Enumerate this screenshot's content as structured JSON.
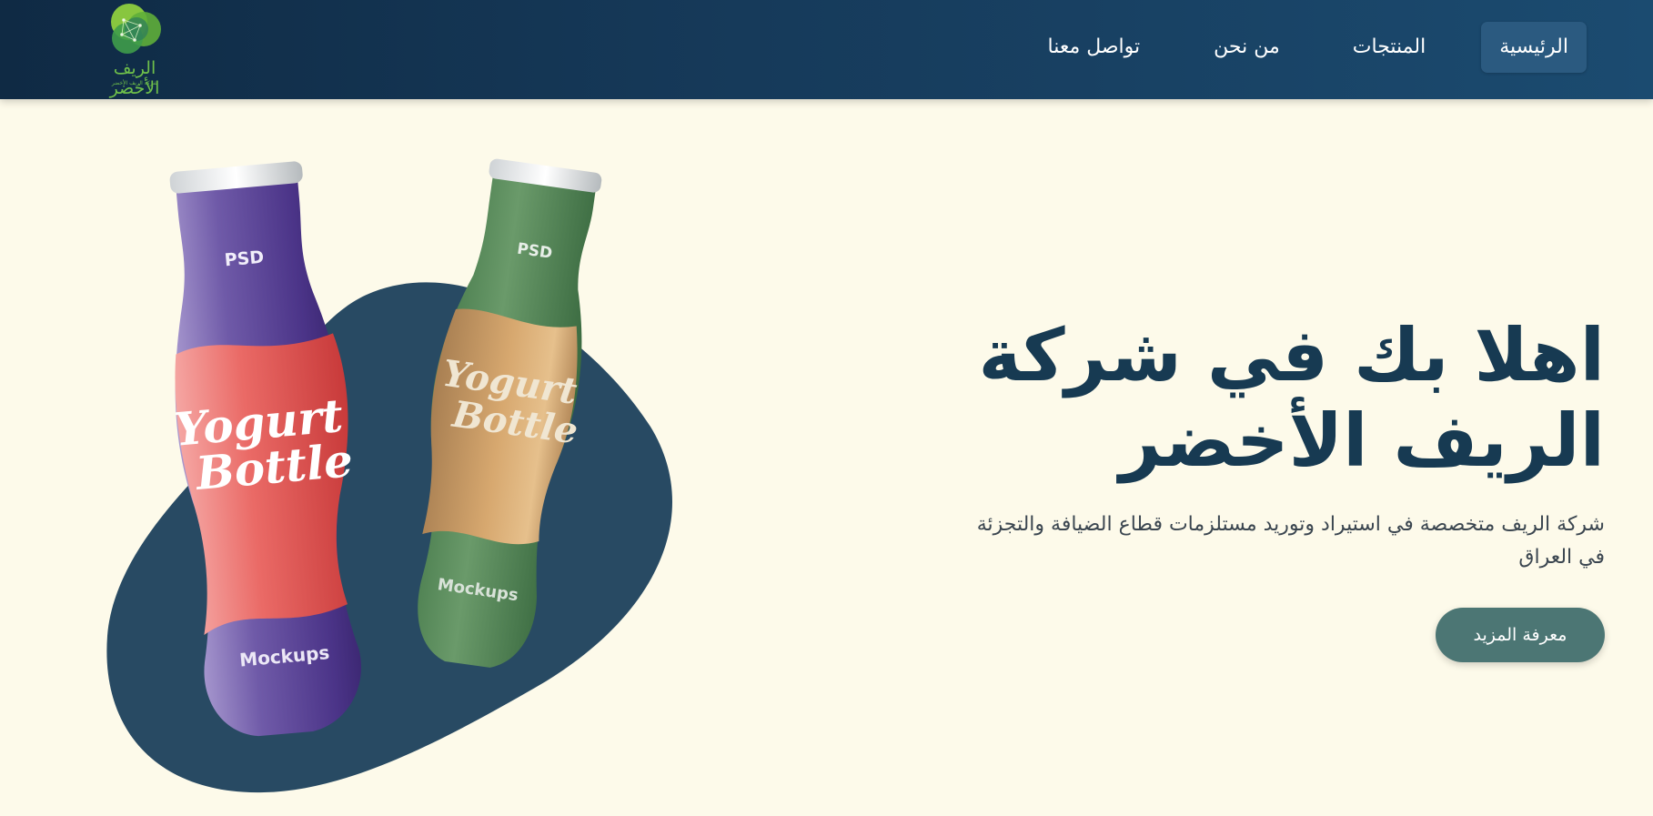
{
  "header": {
    "logo": {
      "title": "الريف الأخضر",
      "subtitle": "شركة الريف الأخضر"
    },
    "nav_items": [
      {
        "label": "الرئيسية",
        "active": true
      },
      {
        "label": "المنتجات",
        "active": false
      },
      {
        "label": "من نحن",
        "active": false
      },
      {
        "label": "تواصل معنا",
        "active": false
      }
    ]
  },
  "hero": {
    "title": "اهلا بك في شركة الريف الأخضر",
    "description": "شركة الريف متخصصة في استيراد وتوريد مستلزمات قطاع الضيافة والتجزئة في العراق",
    "cta_label": "معرفة المزيد"
  },
  "illustration": {
    "bottle_front": {
      "top_label": "PSD",
      "brand_line1": "Yogurt",
      "brand_line2": "Bottle",
      "bottom_label": "Mockups"
    },
    "bottle_back": {
      "top_label": "PSD",
      "brand_line1": "Yogurt",
      "brand_line2": "Bottle",
      "bottom_label": "Mockups"
    }
  },
  "colors": {
    "background": "#fdfaea",
    "header_start": "#0f2a44",
    "header_end": "#1b4b70",
    "active_nav": "#2b5a80",
    "title": "#173a52",
    "cta": "#4c7674",
    "blob": "#284a63",
    "logo_green": "#6fc04a"
  }
}
